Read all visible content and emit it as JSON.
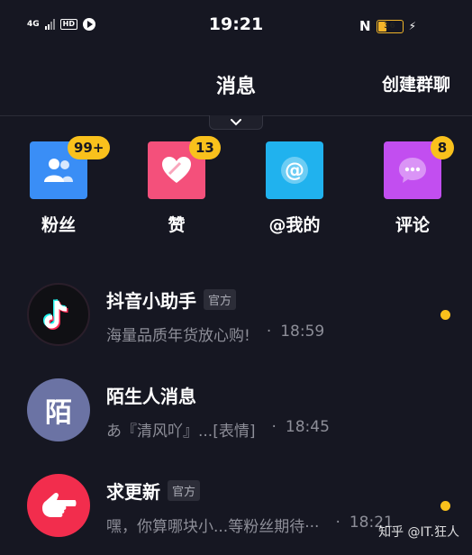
{
  "status_bar": {
    "network": "4G",
    "hd": "HD",
    "time": "19:21",
    "nfc": "N",
    "battery": "36",
    "battery_level_percent": 36
  },
  "header": {
    "title": "消息",
    "create_group": "创建群聊"
  },
  "shortcuts": [
    {
      "label": "粉丝",
      "badge": "99+",
      "icon": "fans-icon",
      "color": "#3a8ef6"
    },
    {
      "label": "赞",
      "badge": "13",
      "icon": "like-heart-icon",
      "color": "#f4507b"
    },
    {
      "label": "@我的",
      "badge": "",
      "icon": "at-icon",
      "color": "#20b2ee"
    },
    {
      "label": "评论",
      "badge": "8",
      "icon": "comment-icon",
      "color": "#c24ef0"
    }
  ],
  "conversations": [
    {
      "name": "抖音小助手",
      "tag": "官方",
      "preview": "海量品质年货放心购!",
      "time": "18:59",
      "unread": true,
      "avatar": "tiktok-logo-icon"
    },
    {
      "name": "陌生人消息",
      "tag": "",
      "preview": "あ『清风吖』...[表情]",
      "time": "18:45",
      "unread": false,
      "avatar_text": "陌"
    },
    {
      "name": "求更新",
      "tag": "官方",
      "preview": "嘿，你算哪块小...等粉丝期待···",
      "time": "18:21",
      "unread": true,
      "avatar": "pointing-hand-icon"
    }
  ],
  "watermark": "知乎 @IT.狂人"
}
